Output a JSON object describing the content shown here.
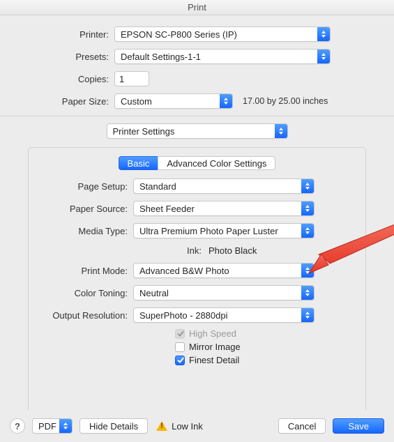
{
  "title": "Print",
  "top": {
    "printer_label": "Printer:",
    "printer_value": "EPSON SC-P800 Series (IP)",
    "presets_label": "Presets:",
    "presets_value": "Default Settings-1-1",
    "copies_label": "Copies:",
    "copies_value": "1",
    "papersize_label": "Paper Size:",
    "papersize_value": "Custom",
    "papersize_hint": "17.00 by 25.00 inches",
    "section_select_value": "Printer Settings"
  },
  "tabs": {
    "basic": "Basic",
    "advanced": "Advanced Color Settings"
  },
  "settings": {
    "page_setup_label": "Page Setup:",
    "page_setup_value": "Standard",
    "paper_source_label": "Paper Source:",
    "paper_source_value": "Sheet Feeder",
    "media_type_label": "Media Type:",
    "media_type_value": "Ultra Premium Photo Paper Luster",
    "ink_label": "Ink:",
    "ink_value": "Photo Black",
    "print_mode_label": "Print Mode:",
    "print_mode_value": "Advanced B&W Photo",
    "color_toning_label": "Color Toning:",
    "color_toning_value": "Neutral",
    "output_res_label": "Output Resolution:",
    "output_res_value": "SuperPhoto - 2880dpi",
    "high_speed_label": "High Speed",
    "mirror_image_label": "Mirror Image",
    "finest_detail_label": "Finest Detail"
  },
  "footer": {
    "pdf_label": "PDF",
    "hide_details": "Hide Details",
    "low_ink": "Low Ink",
    "cancel": "Cancel",
    "save": "Save",
    "help": "?"
  },
  "colors": {
    "accent": "#2f7bff",
    "arrow": "#ef4a3b"
  }
}
